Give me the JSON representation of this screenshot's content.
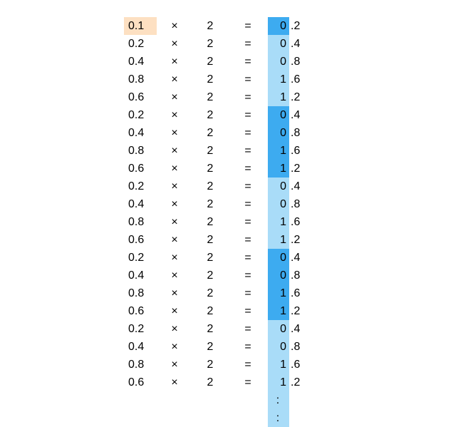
{
  "symbols": {
    "times": "×",
    "equals": "=",
    "multiplier": "2",
    "continuation": ":"
  },
  "colors": {
    "input_highlight": "#fde0c2",
    "bit_light": "#a9dcf8",
    "bit_dark": "#3dabf0"
  },
  "rows": [
    {
      "operand": "0.1",
      "int_bit": "0",
      "fraction": ".2",
      "operand_hl": true,
      "dark_group": true
    },
    {
      "operand": "0.2",
      "int_bit": "0",
      "fraction": ".4",
      "operand_hl": false,
      "dark_group": false
    },
    {
      "operand": "0.4",
      "int_bit": "0",
      "fraction": ".8",
      "operand_hl": false,
      "dark_group": false
    },
    {
      "operand": "0.8",
      "int_bit": "1",
      "fraction": ".6",
      "operand_hl": false,
      "dark_group": false
    },
    {
      "operand": "0.6",
      "int_bit": "1",
      "fraction": ".2",
      "operand_hl": false,
      "dark_group": false
    },
    {
      "operand": "0.2",
      "int_bit": "0",
      "fraction": ".4",
      "operand_hl": false,
      "dark_group": true
    },
    {
      "operand": "0.4",
      "int_bit": "0",
      "fraction": ".8",
      "operand_hl": false,
      "dark_group": true
    },
    {
      "operand": "0.8",
      "int_bit": "1",
      "fraction": ".6",
      "operand_hl": false,
      "dark_group": true
    },
    {
      "operand": "0.6",
      "int_bit": "1",
      "fraction": ".2",
      "operand_hl": false,
      "dark_group": true
    },
    {
      "operand": "0.2",
      "int_bit": "0",
      "fraction": ".4",
      "operand_hl": false,
      "dark_group": false
    },
    {
      "operand": "0.4",
      "int_bit": "0",
      "fraction": ".8",
      "operand_hl": false,
      "dark_group": false
    },
    {
      "operand": "0.8",
      "int_bit": "1",
      "fraction": ".6",
      "operand_hl": false,
      "dark_group": false
    },
    {
      "operand": "0.6",
      "int_bit": "1",
      "fraction": ".2",
      "operand_hl": false,
      "dark_group": false
    },
    {
      "operand": "0.2",
      "int_bit": "0",
      "fraction": ".4",
      "operand_hl": false,
      "dark_group": true
    },
    {
      "operand": "0.4",
      "int_bit": "0",
      "fraction": ".8",
      "operand_hl": false,
      "dark_group": true
    },
    {
      "operand": "0.8",
      "int_bit": "1",
      "fraction": ".6",
      "operand_hl": false,
      "dark_group": true
    },
    {
      "operand": "0.6",
      "int_bit": "1",
      "fraction": ".2",
      "operand_hl": false,
      "dark_group": true
    },
    {
      "operand": "0.2",
      "int_bit": "0",
      "fraction": ".4",
      "operand_hl": false,
      "dark_group": false
    },
    {
      "operand": "0.4",
      "int_bit": "0",
      "fraction": ".8",
      "operand_hl": false,
      "dark_group": false
    },
    {
      "operand": "0.8",
      "int_bit": "1",
      "fraction": ".6",
      "operand_hl": false,
      "dark_group": false
    },
    {
      "operand": "0.6",
      "int_bit": "1",
      "fraction": ".2",
      "operand_hl": false,
      "dark_group": false
    }
  ],
  "continuation_rows": 2
}
